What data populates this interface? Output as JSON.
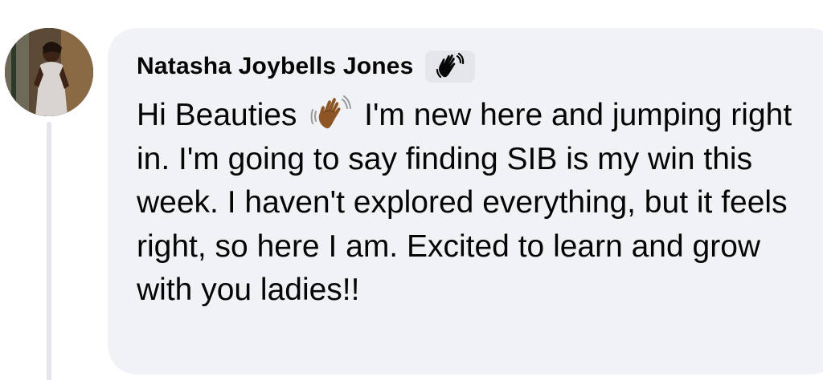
{
  "comment": {
    "author": "Natasha Joybells Jones",
    "author_badge_icon": "waving-hand-icon",
    "text_before_emoji": "Hi Beauties ",
    "emoji": "waving-hand-emoji",
    "text_after_emoji": " I'm new here and jumping right in. I'm going to say finding SIB is my win this week. I haven't explored everything, but it feels right, so here I am. Excited to learn and grow with you ladies!!"
  },
  "colors": {
    "bubble_background": "#f0f2f5",
    "text": "#050505",
    "thread_line": "#e4e6eb",
    "emoji_skin": "#8d5524"
  }
}
